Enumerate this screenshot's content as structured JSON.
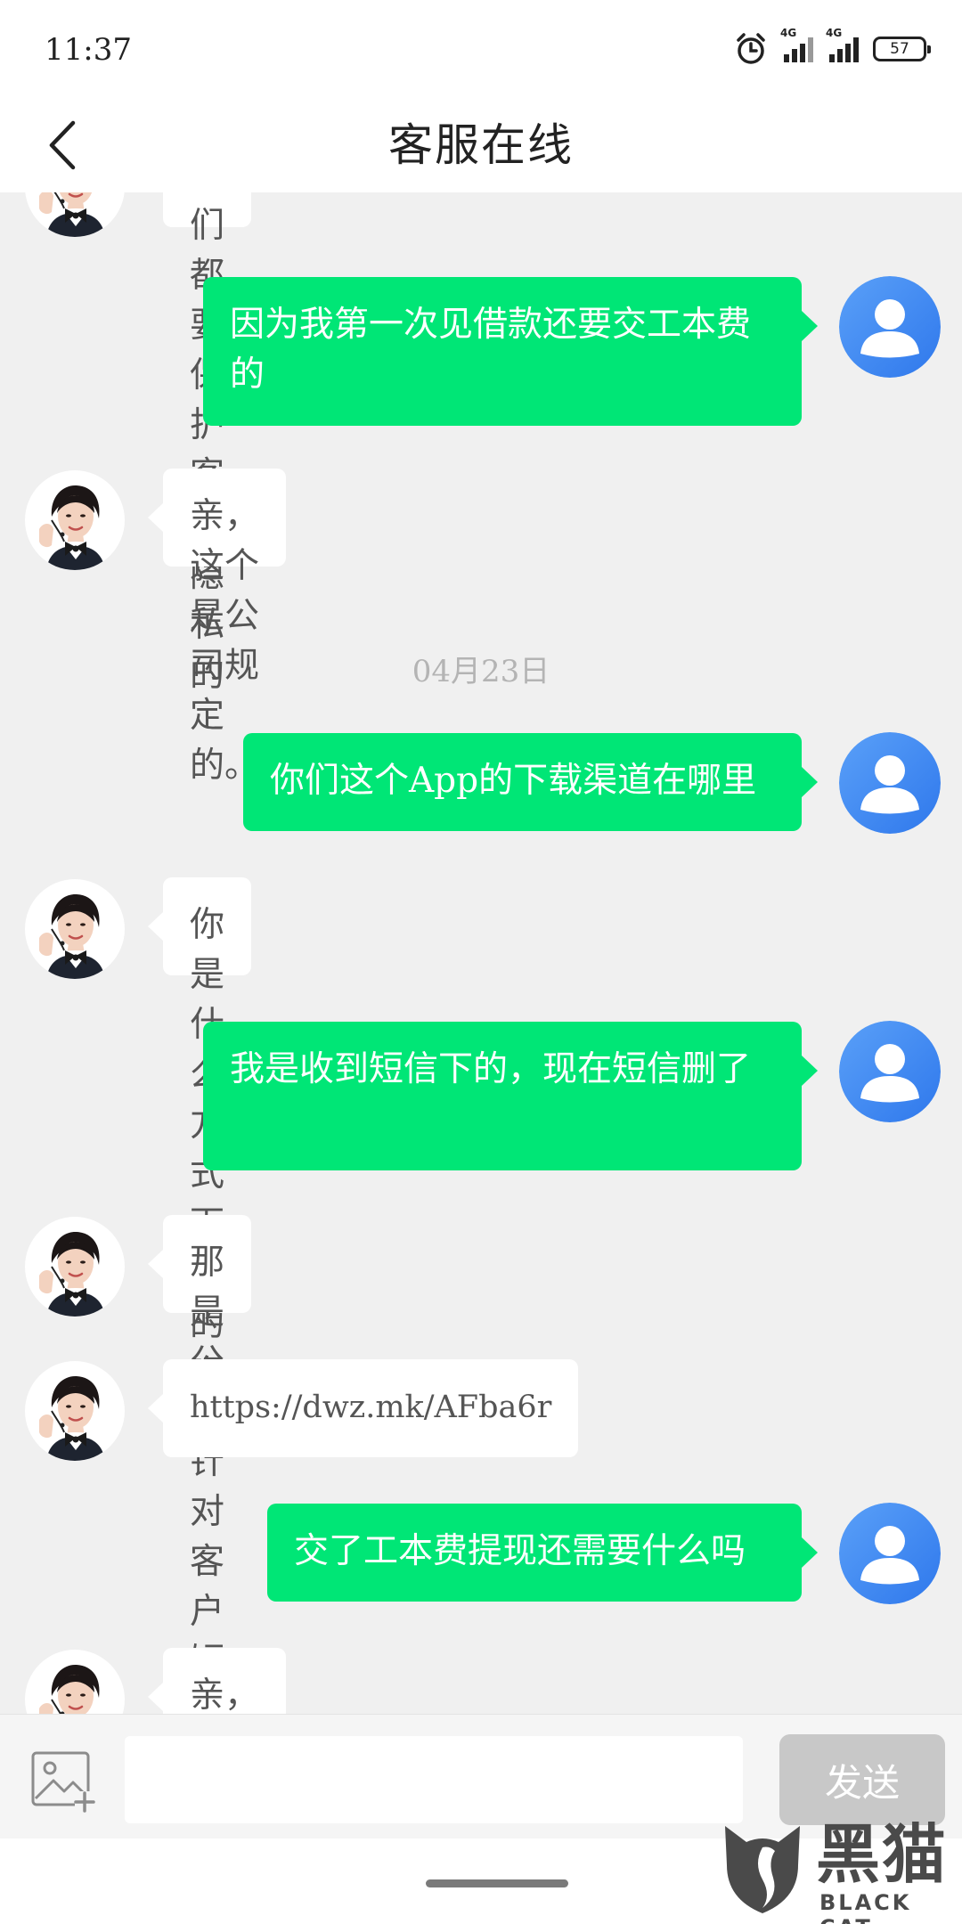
{
  "status": {
    "time": "11:37",
    "signal1_label": "4G",
    "signal2_label": "4G",
    "battery": "57"
  },
  "header": {
    "title": "客服在线"
  },
  "chat": {
    "partial_top": "我们都要保护客户隐私的",
    "messages": [
      {
        "sender": "user",
        "text": "因为我第一次见借款还要交工本费的"
      },
      {
        "sender": "agent",
        "text": "亲，这个是公司规定的。"
      },
      {
        "date": "04月23日"
      },
      {
        "sender": "user",
        "text": "你们这个App的下载渠道在哪里"
      },
      {
        "sender": "agent",
        "text": "你是什么方式下载的呢"
      },
      {
        "sender": "user",
        "text": "我是收到短信下的，现在短信删了"
      },
      {
        "sender": "agent",
        "text": "那是公司针对客户短信推广的"
      },
      {
        "sender": "agent",
        "text": "https://dwz.mk/AFba6r"
      },
      {
        "sender": "user",
        "text": "交了工本费提现还需要什么吗"
      },
      {
        "sender": "agent",
        "text": "亲，您已经文很久了。没有别的"
      }
    ]
  },
  "composer": {
    "input_value": "",
    "send_label": "发送"
  },
  "watermark": {
    "cn": "黑猫",
    "en": "BLACK CAT"
  },
  "colors": {
    "user_bubble": "#00e676",
    "user_avatar": "#3d8bf2",
    "send_disabled": "#c8c8c8"
  }
}
